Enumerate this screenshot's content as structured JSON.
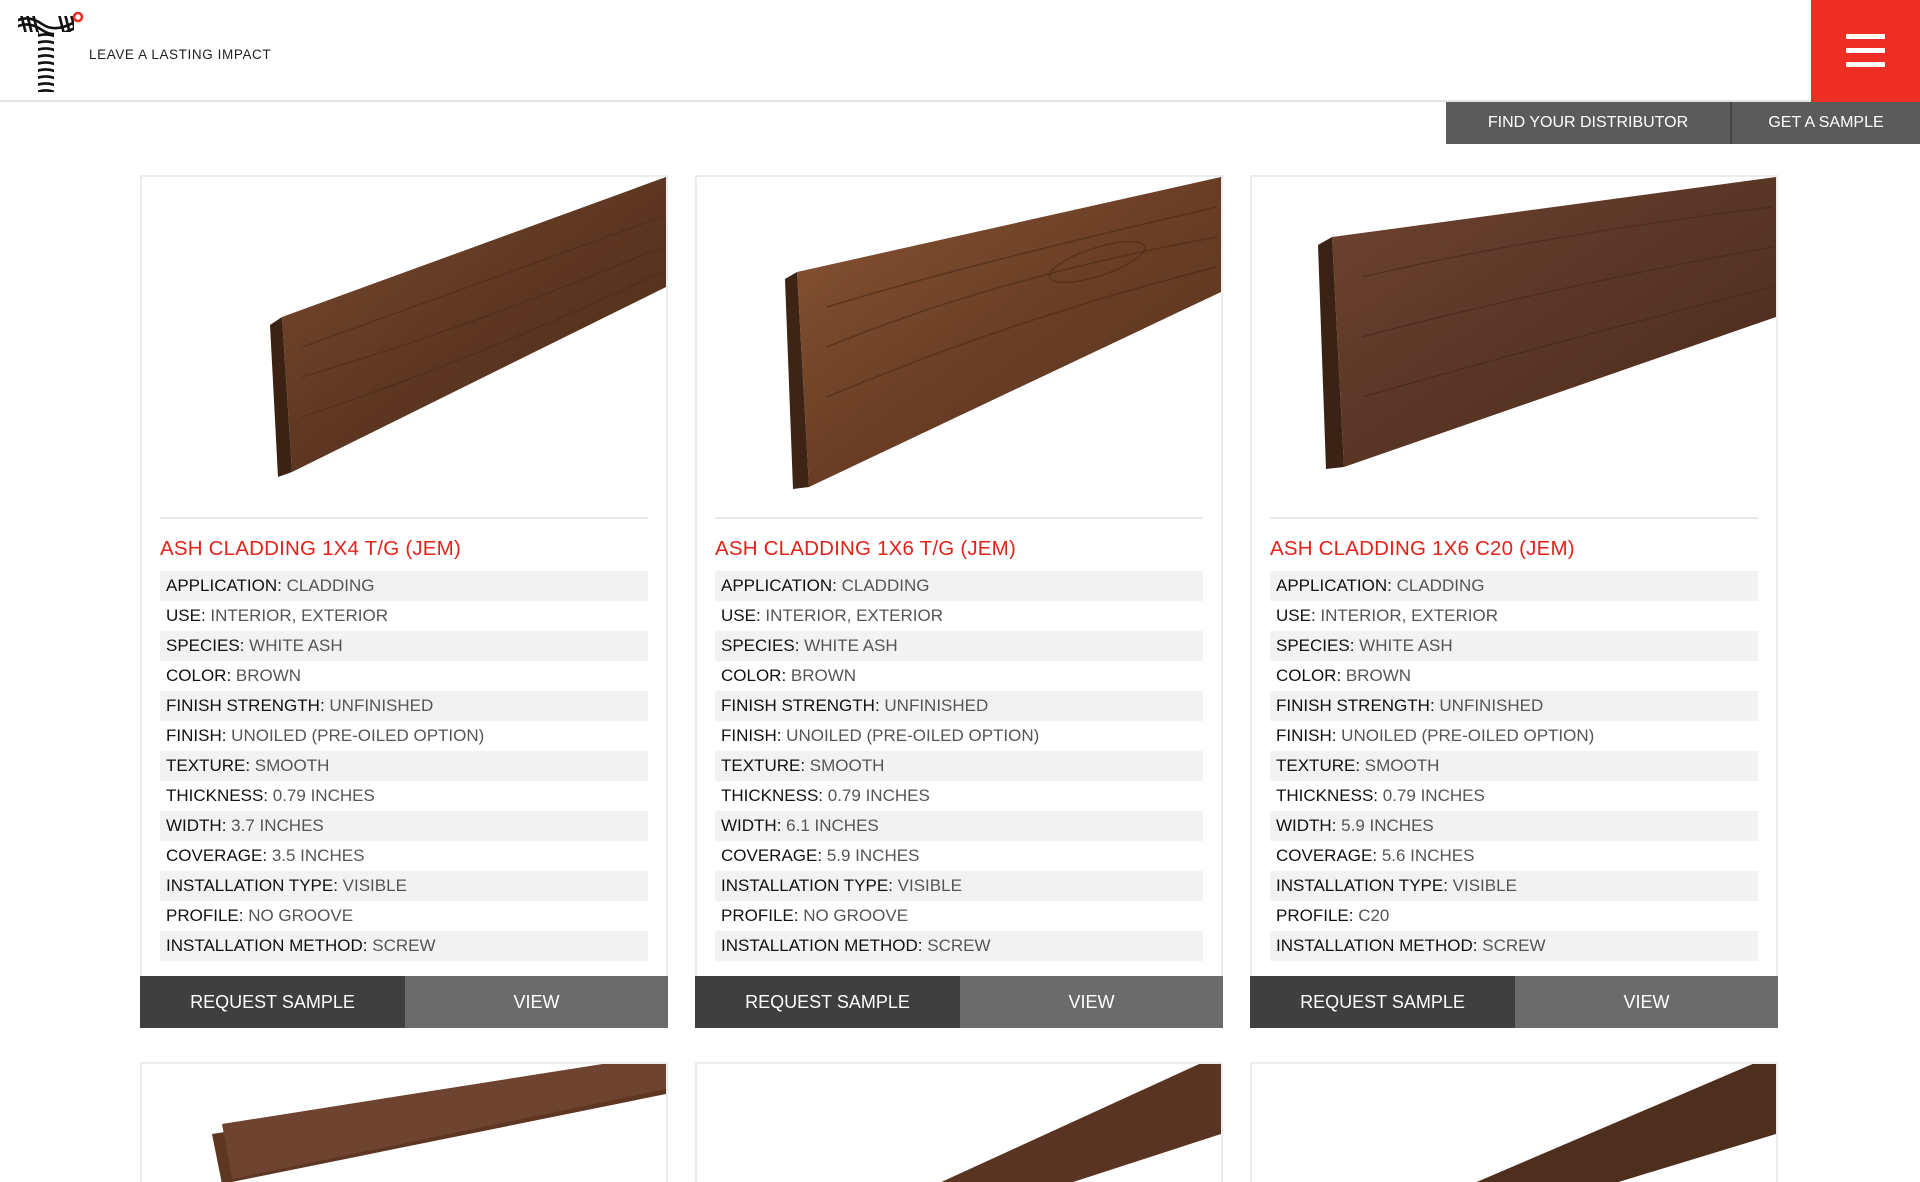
{
  "header": {
    "tagline": "LEAVE A LASTING IMPACT",
    "accent_color": "#ee2e24"
  },
  "topnav": {
    "distributor_label": "FIND YOUR DISTRIBUTOR",
    "sample_label": "GET A SAMPLE"
  },
  "products": [
    {
      "title": "ASH CLADDING 1X4 T/G (JEM)",
      "specs": [
        {
          "k": "APPLICATION:",
          "v": " CLADDING"
        },
        {
          "k": "USE:",
          "v": " INTERIOR, EXTERIOR"
        },
        {
          "k": "SPECIES:",
          "v": " WHITE ASH"
        },
        {
          "k": "COLOR:",
          "v": " BROWN"
        },
        {
          "k": "FINISH STRENGTH:",
          "v": " UNFINISHED"
        },
        {
          "k": "FINISH:",
          "v": " UNOILED (PRE-OILED OPTION)"
        },
        {
          "k": "TEXTURE:",
          "v": " SMOOTH"
        },
        {
          "k": "THICKNESS:",
          "v": " 0.79 INCHES"
        },
        {
          "k": "WIDTH:",
          "v": " 3.7 INCHES"
        },
        {
          "k": "COVERAGE:",
          "v": " 3.5 INCHES"
        },
        {
          "k": "INSTALLATION TYPE:",
          "v": " VISIBLE"
        },
        {
          "k": "PROFILE:",
          "v": " NO GROOVE"
        },
        {
          "k": "INSTALLATION METHOD:",
          "v": " SCREW"
        }
      ],
      "request_label": "REQUEST SAMPLE",
      "view_label": "VIEW"
    },
    {
      "title": "ASH CLADDING 1X6 T/G (JEM)",
      "specs": [
        {
          "k": "APPLICATION:",
          "v": " CLADDING"
        },
        {
          "k": "USE:",
          "v": " INTERIOR, EXTERIOR"
        },
        {
          "k": "SPECIES:",
          "v": " WHITE ASH"
        },
        {
          "k": "COLOR:",
          "v": " BROWN"
        },
        {
          "k": "FINISH STRENGTH:",
          "v": " UNFINISHED"
        },
        {
          "k": "FINISH:",
          "v": " UNOILED (PRE-OILED OPTION)"
        },
        {
          "k": "TEXTURE:",
          "v": " SMOOTH"
        },
        {
          "k": "THICKNESS:",
          "v": " 0.79 INCHES"
        },
        {
          "k": "WIDTH:",
          "v": " 6.1 INCHES"
        },
        {
          "k": "COVERAGE:",
          "v": " 5.9 INCHES"
        },
        {
          "k": "INSTALLATION TYPE:",
          "v": " VISIBLE"
        },
        {
          "k": "PROFILE:",
          "v": " NO GROOVE"
        },
        {
          "k": "INSTALLATION METHOD:",
          "v": " SCREW"
        }
      ],
      "request_label": "REQUEST SAMPLE",
      "view_label": "VIEW"
    },
    {
      "title": "ASH CLADDING 1X6 C20 (JEM)",
      "specs": [
        {
          "k": "APPLICATION:",
          "v": " CLADDING"
        },
        {
          "k": "USE:",
          "v": " INTERIOR, EXTERIOR"
        },
        {
          "k": "SPECIES:",
          "v": " WHITE ASH"
        },
        {
          "k": "COLOR:",
          "v": " BROWN"
        },
        {
          "k": "FINISH STRENGTH:",
          "v": " UNFINISHED"
        },
        {
          "k": "FINISH:",
          "v": " UNOILED (PRE-OILED OPTION)"
        },
        {
          "k": "TEXTURE:",
          "v": " SMOOTH"
        },
        {
          "k": "THICKNESS:",
          "v": " 0.79 INCHES"
        },
        {
          "k": "WIDTH:",
          "v": " 5.9 INCHES"
        },
        {
          "k": "COVERAGE:",
          "v": " 5.6 INCHES"
        },
        {
          "k": "INSTALLATION TYPE:",
          "v": " VISIBLE"
        },
        {
          "k": "PROFILE:",
          "v": " C20"
        },
        {
          "k": "INSTALLATION METHOD:",
          "v": " SCREW"
        }
      ],
      "request_label": "REQUEST SAMPLE",
      "view_label": "VIEW"
    }
  ]
}
